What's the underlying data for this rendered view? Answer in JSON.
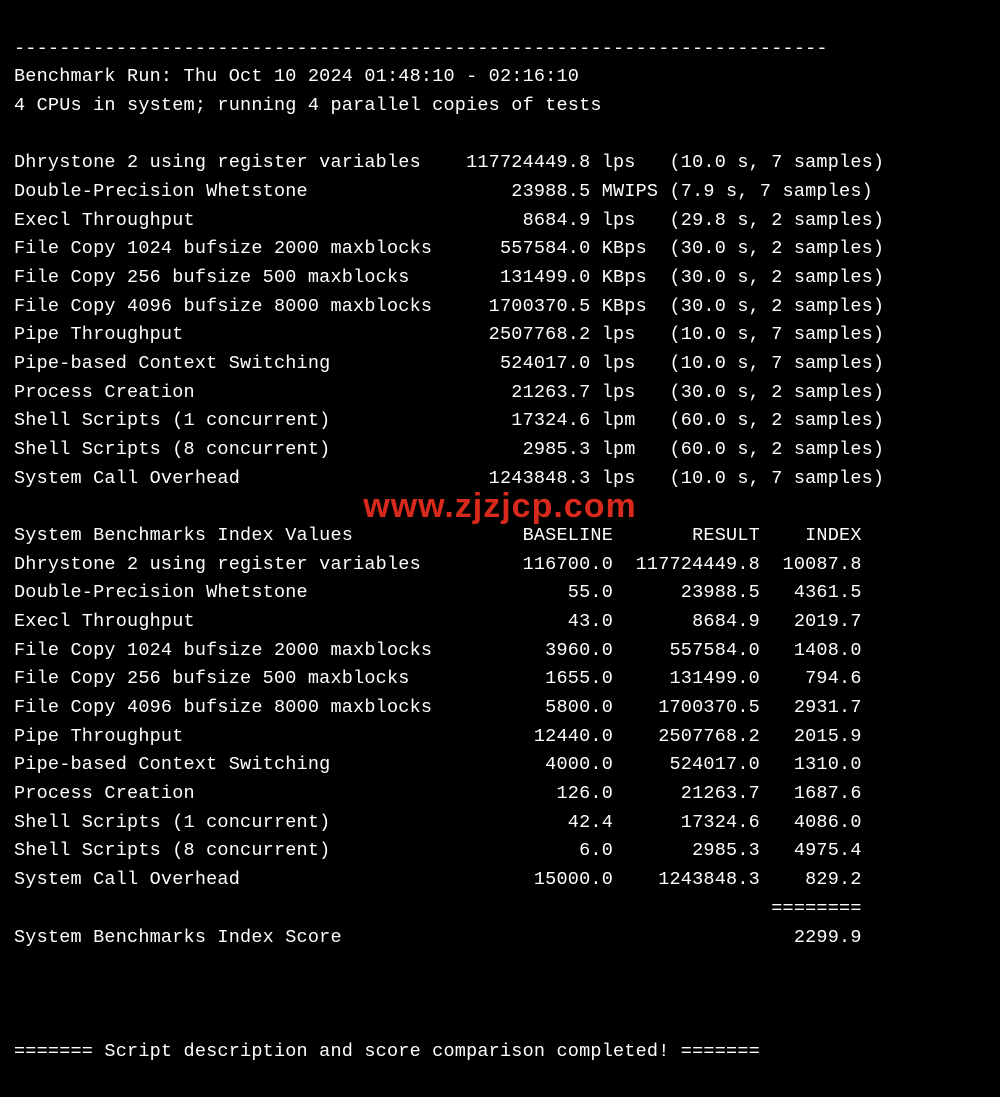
{
  "separator_top": "------------------------------------------------------------------------",
  "run_line": "Benchmark Run: Thu Oct 10 2024 01:48:10 - 02:16:10",
  "cpu_line": "4 CPUs in system; running 4 parallel copies of tests",
  "tests": [
    {
      "name": "Dhrystone 2 using register variables",
      "value": "117724449.8",
      "unit": "lps",
      "timing": "(10.0 s, 7 samples)"
    },
    {
      "name": "Double-Precision Whetstone",
      "value": "23988.5",
      "unit": "MWIPS",
      "timing": "(7.9 s, 7 samples)"
    },
    {
      "name": "Execl Throughput",
      "value": "8684.9",
      "unit": "lps",
      "timing": "(29.8 s, 2 samples)"
    },
    {
      "name": "File Copy 1024 bufsize 2000 maxblocks",
      "value": "557584.0",
      "unit": "KBps",
      "timing": "(30.0 s, 2 samples)"
    },
    {
      "name": "File Copy 256 bufsize 500 maxblocks",
      "value": "131499.0",
      "unit": "KBps",
      "timing": "(30.0 s, 2 samples)"
    },
    {
      "name": "File Copy 4096 bufsize 8000 maxblocks",
      "value": "1700370.5",
      "unit": "KBps",
      "timing": "(30.0 s, 2 samples)"
    },
    {
      "name": "Pipe Throughput",
      "value": "2507768.2",
      "unit": "lps",
      "timing": "(10.0 s, 7 samples)"
    },
    {
      "name": "Pipe-based Context Switching",
      "value": "524017.0",
      "unit": "lps",
      "timing": "(10.0 s, 7 samples)"
    },
    {
      "name": "Process Creation",
      "value": "21263.7",
      "unit": "lps",
      "timing": "(30.0 s, 2 samples)"
    },
    {
      "name": "Shell Scripts (1 concurrent)",
      "value": "17324.6",
      "unit": "lpm",
      "timing": "(60.0 s, 2 samples)"
    },
    {
      "name": "Shell Scripts (8 concurrent)",
      "value": "2985.3",
      "unit": "lpm",
      "timing": "(60.0 s, 2 samples)"
    },
    {
      "name": "System Call Overhead",
      "value": "1243848.3",
      "unit": "lps",
      "timing": "(10.0 s, 7 samples)"
    }
  ],
  "index_header": {
    "title": "System Benchmarks Index Values",
    "c1": "BASELINE",
    "c2": "RESULT",
    "c3": "INDEX"
  },
  "index_rows": [
    {
      "name": "Dhrystone 2 using register variables",
      "baseline": "116700.0",
      "result": "117724449.8",
      "index": "10087.8"
    },
    {
      "name": "Double-Precision Whetstone",
      "baseline": "55.0",
      "result": "23988.5",
      "index": "4361.5"
    },
    {
      "name": "Execl Throughput",
      "baseline": "43.0",
      "result": "8684.9",
      "index": "2019.7"
    },
    {
      "name": "File Copy 1024 bufsize 2000 maxblocks",
      "baseline": "3960.0",
      "result": "557584.0",
      "index": "1408.0"
    },
    {
      "name": "File Copy 256 bufsize 500 maxblocks",
      "baseline": "1655.0",
      "result": "131499.0",
      "index": "794.6"
    },
    {
      "name": "File Copy 4096 bufsize 8000 maxblocks",
      "baseline": "5800.0",
      "result": "1700370.5",
      "index": "2931.7"
    },
    {
      "name": "Pipe Throughput",
      "baseline": "12440.0",
      "result": "2507768.2",
      "index": "2015.9"
    },
    {
      "name": "Pipe-based Context Switching",
      "baseline": "4000.0",
      "result": "524017.0",
      "index": "1310.0"
    },
    {
      "name": "Process Creation",
      "baseline": "126.0",
      "result": "21263.7",
      "index": "1687.6"
    },
    {
      "name": "Shell Scripts (1 concurrent)",
      "baseline": "42.4",
      "result": "17324.6",
      "index": "4086.0"
    },
    {
      "name": "Shell Scripts (8 concurrent)",
      "baseline": "6.0",
      "result": "2985.3",
      "index": "4975.4"
    },
    {
      "name": "System Call Overhead",
      "baseline": "15000.0",
      "result": "1243848.3",
      "index": "829.2"
    }
  ],
  "score_rule": "                                                                   ========",
  "score_line_label": "System Benchmarks Index Score",
  "score_value": "2299.9",
  "footer": "======= Script description and score comparison completed! =======",
  "watermark": "www.zjzjcp.com"
}
